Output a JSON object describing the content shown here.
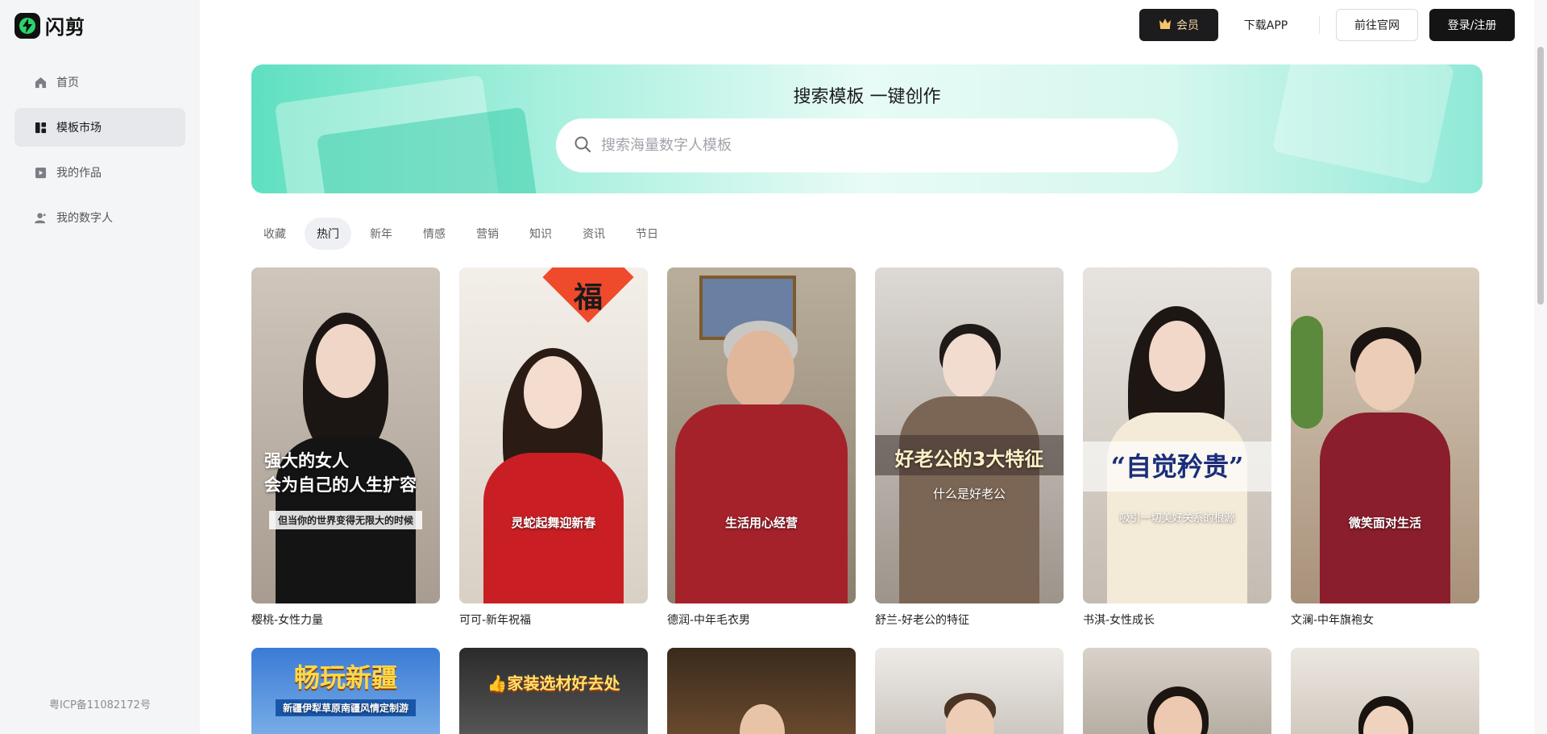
{
  "brand": {
    "name": "闪剪"
  },
  "sidebar": {
    "items": [
      {
        "label": "首页",
        "icon": "home-icon"
      },
      {
        "label": "模板市场",
        "icon": "template-icon",
        "active": true
      },
      {
        "label": "我的作品",
        "icon": "video-icon"
      },
      {
        "label": "我的数字人",
        "icon": "user-icon"
      }
    ],
    "icp": "粤ICP备11082172号"
  },
  "header": {
    "vip_label": "会员",
    "download_label": "下载APP",
    "website_label": "前往官网",
    "login_label": "登录/注册"
  },
  "banner": {
    "title": "搜索模板 一键创作",
    "search_placeholder": "搜索海量数字人模板"
  },
  "tabs": [
    {
      "label": "收藏"
    },
    {
      "label": "热门",
      "active": true
    },
    {
      "label": "新年"
    },
    {
      "label": "情感"
    },
    {
      "label": "营销"
    },
    {
      "label": "知识"
    },
    {
      "label": "资讯"
    },
    {
      "label": "节日"
    }
  ],
  "templates": [
    {
      "title": "樱桃-女性力量",
      "overlay": [
        "强大的女人",
        "会为自己的人生扩容"
      ],
      "caption": "但当你的世界变得无限大的时候"
    },
    {
      "title": "可可-新年祝福",
      "overlay": [
        "福"
      ],
      "caption": "灵蛇起舞迎新春"
    },
    {
      "title": "德润-中年毛衣男",
      "overlay": [],
      "caption": "生活用心经营"
    },
    {
      "title": "舒兰-好老公的特征",
      "overlay": [
        "好老公的3大特征"
      ],
      "caption": "什么是好老公"
    },
    {
      "title": "书淇-女性成长",
      "overlay": [
        "“自觉矜贵”"
      ],
      "caption": "吸引一切美好关系的根源"
    },
    {
      "title": "文澜-中年旗袍女",
      "overlay": [],
      "caption": "微笑面对生活"
    }
  ],
  "row2": [
    {
      "overlay": "畅玩新疆",
      "caption": "新疆伊犁草原南疆风情定制游"
    },
    {
      "overlay": "👍家装选材好去处",
      "caption": ""
    },
    {
      "overlay": "",
      "caption": ""
    },
    {
      "overlay": "",
      "caption": ""
    },
    {
      "overlay": "",
      "caption": ""
    },
    {
      "overlay": "",
      "caption": ""
    }
  ],
  "colors": {
    "accent": "#141414",
    "vip_text": "#f6d9a2",
    "logo_green": "#2bd46b",
    "banner_teal": "#5fe0c0"
  }
}
